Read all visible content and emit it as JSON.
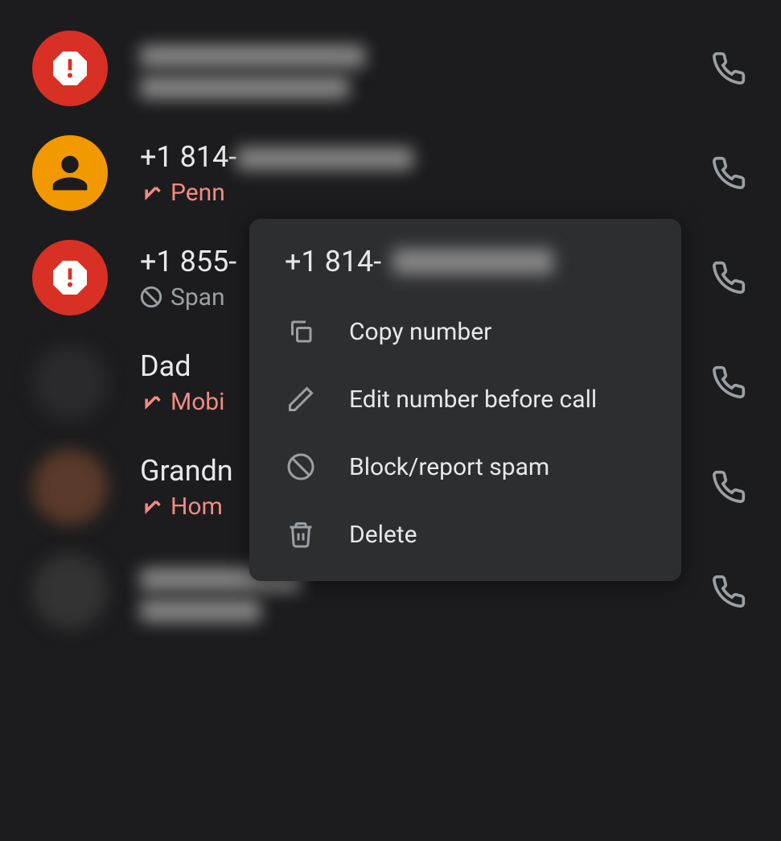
{
  "calls": [
    {
      "title": "",
      "sub": "",
      "avatar": "spam",
      "blurred": true
    },
    {
      "title": "+1 814-",
      "sub": "Penn",
      "avatar": "person",
      "missed": true
    },
    {
      "title": "+1 855-",
      "sub": "Span",
      "avatar": "spam",
      "blocked": true
    },
    {
      "title": "Dad",
      "sub": "Mobi",
      "avatar": "blur",
      "missed": true
    },
    {
      "title": "Grandn",
      "sub": "Hom",
      "avatar": "blur2",
      "missed": true
    },
    {
      "title": "",
      "sub": "",
      "avatar": "blur3",
      "blurred": true
    }
  ],
  "menu": {
    "title_prefix": "+1 814-",
    "items": {
      "copy": "Copy number",
      "edit": "Edit number before call",
      "block": "Block/report spam",
      "delete": "Delete"
    }
  }
}
